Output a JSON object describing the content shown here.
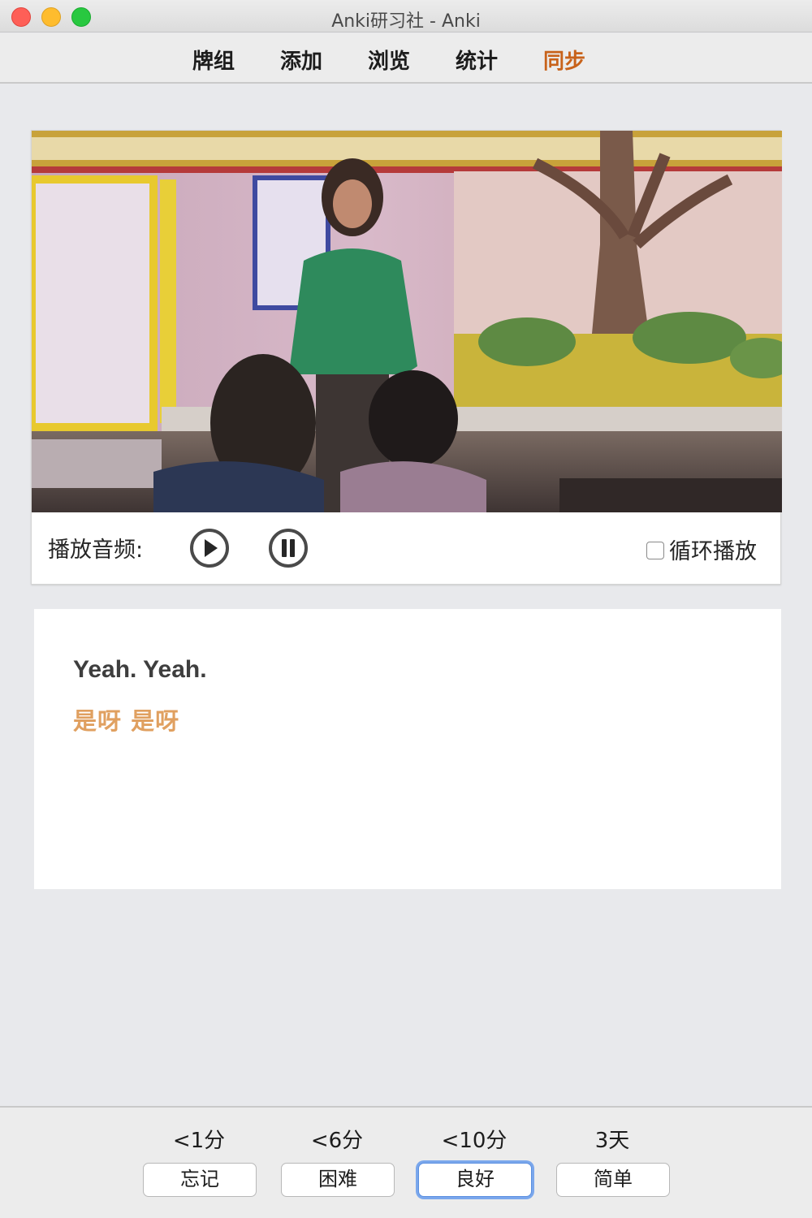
{
  "window": {
    "title": "Anki研习社 - Anki"
  },
  "toolbar": {
    "items": [
      {
        "label": "牌组"
      },
      {
        "label": "添加"
      },
      {
        "label": "浏览"
      },
      {
        "label": "统计"
      },
      {
        "label": "同步",
        "active": true
      }
    ],
    "active_color": "#c8621a"
  },
  "player": {
    "audio_label": "播放音频:",
    "play_icon": "play-circle-icon",
    "pause_icon": "pause-circle-icon",
    "loop_label": "循环播放",
    "loop_checked": false
  },
  "card": {
    "english": "Yeah. Yeah.",
    "chinese": "是呀  是呀",
    "chinese_color": "#e0a060"
  },
  "answers": [
    {
      "interval": "<1分",
      "label": "忘记"
    },
    {
      "interval": "<6分",
      "label": "困难"
    },
    {
      "interval": "<10分",
      "label": "良好",
      "default": true
    },
    {
      "interval": "3天",
      "label": "简单"
    }
  ]
}
